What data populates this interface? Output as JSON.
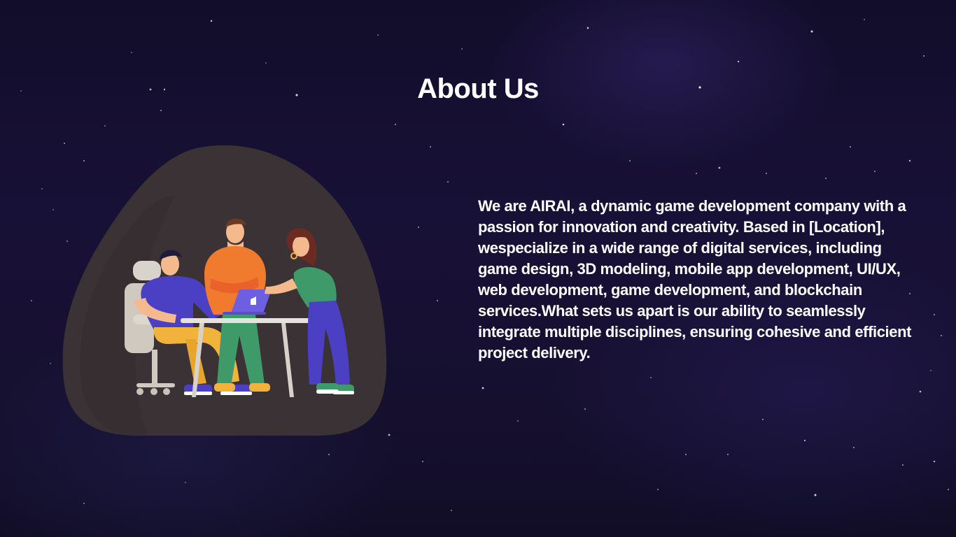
{
  "page": {
    "title": "About Us"
  },
  "about": {
    "body": "We are AIRAI, a dynamic game development company with a passion for innovation and creativity. Based in [Location], wespecialize in a wide range of digital services, including game design, 3D modeling, mobile app development, UI/UX, web development, game development, and blockchain services.What sets us apart is our ability to seamlessly integrate multiple disciplines, ensuring cohesive and efficient project delivery."
  },
  "illustration": {
    "icon": "team-collaboration-illustration"
  },
  "colors": {
    "background": "#16102f",
    "text": "#ffffff",
    "blob": "#3a3235",
    "orange_shirt": "#f07a2e",
    "blue_shirt": "#4b3fc4",
    "green_shirt": "#3f9a6a",
    "pants_yellow": "#f2b33c"
  }
}
